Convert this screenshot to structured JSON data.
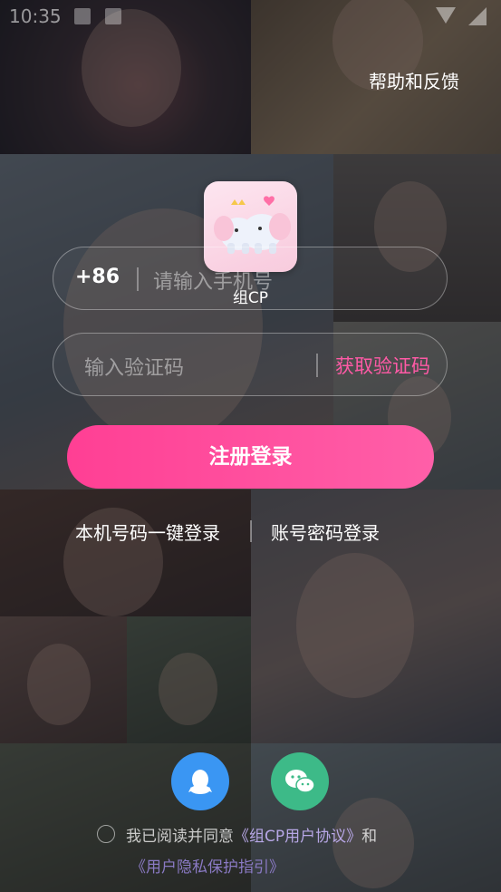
{
  "status_bar": {
    "time": "10:35"
  },
  "header": {
    "help_label": "帮助和反馈"
  },
  "app": {
    "name": "组CP",
    "logo_icon": "elephant-logo-icon"
  },
  "phone_field": {
    "country_code": "+86",
    "placeholder": "请输入手机号"
  },
  "code_field": {
    "placeholder": "输入验证码",
    "get_code_label": "获取验证码"
  },
  "submit": {
    "label": "注册登录"
  },
  "alt_login": {
    "one_click_label": "本机号码一键登录",
    "password_label": "账号密码登录"
  },
  "social": {
    "qq_icon": "qq-icon",
    "wechat_icon": "wechat-icon"
  },
  "agreement": {
    "prefix": "我已阅读并同意",
    "user_agreement": "《组CP用户协议》",
    "joiner": "和",
    "privacy": "《用户隐私保护指引》"
  },
  "colors": {
    "accent": "#ff4f9e",
    "qq": "#3a96f3",
    "wechat": "#3dba88"
  }
}
